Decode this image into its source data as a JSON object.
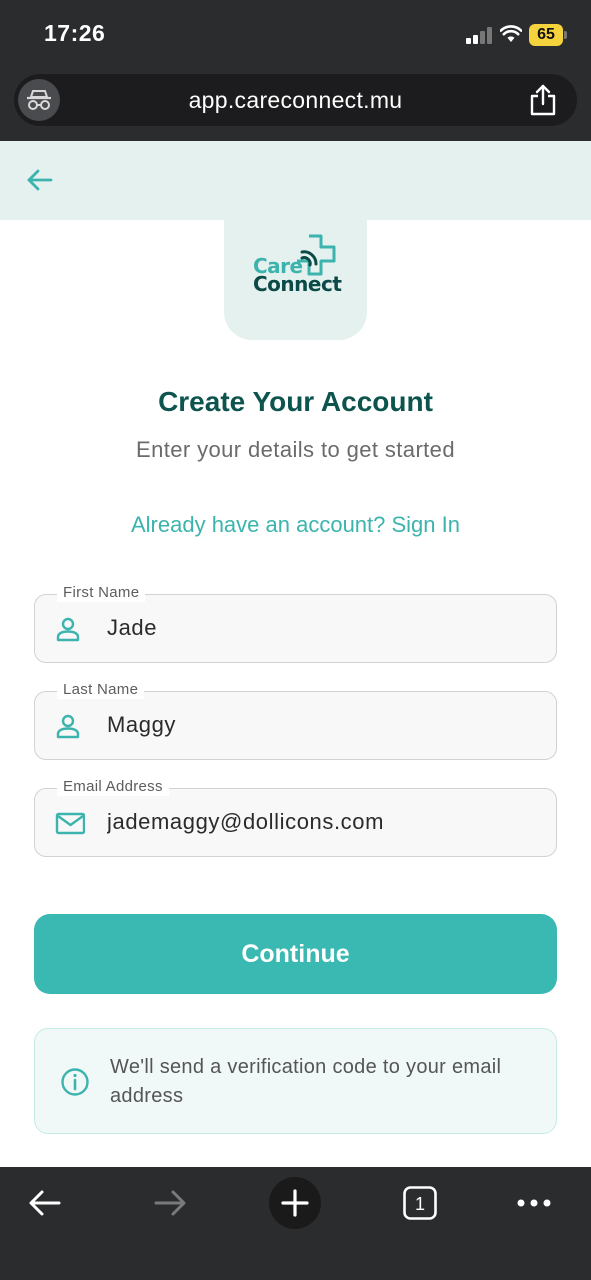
{
  "status_bar": {
    "time": "17:26",
    "battery": "65",
    "colors": {
      "battery": "#f5d33c"
    }
  },
  "browser": {
    "url": "app.careconnect.mu",
    "icons": [
      "incognito-icon",
      "share-icon"
    ]
  },
  "header": {
    "back_icon": "arrow-left-icon",
    "accent_color": "#3cb4ad"
  },
  "logo": {
    "line1": "Care",
    "line2": "Connect"
  },
  "main": {
    "title": "Create Your Account",
    "subtitle": "Enter your details to get started",
    "signin_link": "Already have an account? Sign In"
  },
  "form": {
    "fields": [
      {
        "label": "First Name",
        "value": "Jade",
        "icon": "user-icon"
      },
      {
        "label": "Last Name",
        "value": "Maggy",
        "icon": "user-icon"
      },
      {
        "label": "Email Address",
        "value": "jademaggy@dollicons.com",
        "icon": "mail-icon"
      }
    ],
    "continue_label": "Continue",
    "button_color": "#3ab8b2"
  },
  "info": {
    "icon": "info-icon",
    "text": "We'll send a verification code to your email address"
  },
  "toolbar": {
    "tab_count": "1",
    "icons": [
      "back-icon",
      "forward-icon",
      "plus-icon",
      "tabs-icon",
      "more-icon"
    ]
  }
}
